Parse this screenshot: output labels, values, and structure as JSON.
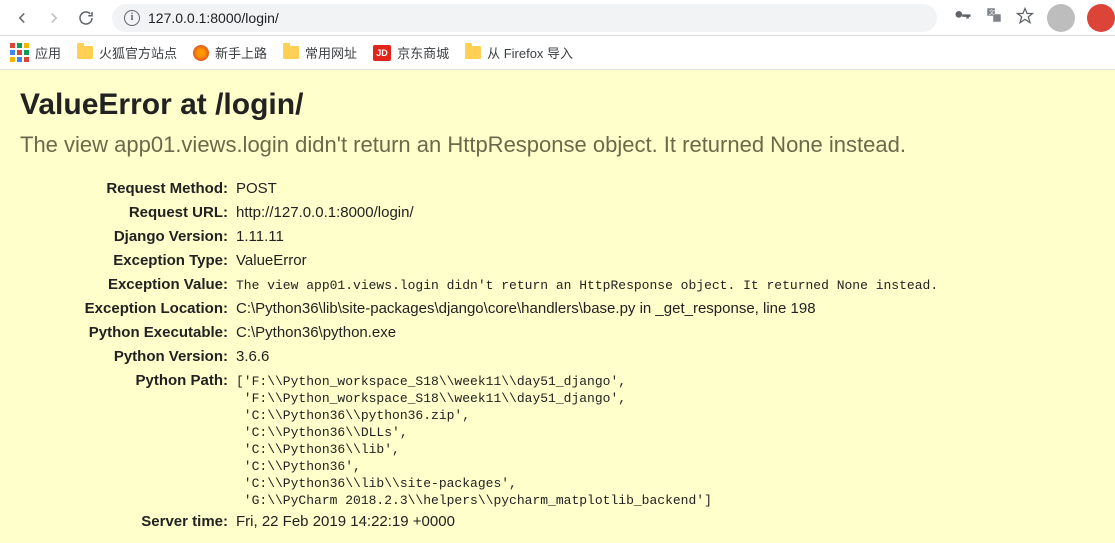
{
  "toolbar": {
    "url": "127.0.0.1:8000/login/"
  },
  "bookmarks": {
    "apps": "应用",
    "items": [
      {
        "label": "火狐官方站点",
        "icon": "folder"
      },
      {
        "label": "新手上路",
        "icon": "firefox"
      },
      {
        "label": "常用网址",
        "icon": "folder"
      },
      {
        "label": "京东商城",
        "icon": "jd"
      },
      {
        "label": "从 Firefox 导入",
        "icon": "folder"
      }
    ]
  },
  "error": {
    "title": "ValueError at /login/",
    "subtitle": "The view app01.views.login didn't return an HttpResponse object. It returned None instead.",
    "rows": {
      "request_method": {
        "label": "Request Method:",
        "value": "POST"
      },
      "request_url": {
        "label": "Request URL:",
        "value": "http://127.0.0.1:8000/login/"
      },
      "django_version": {
        "label": "Django Version:",
        "value": "1.11.11"
      },
      "exception_type": {
        "label": "Exception Type:",
        "value": "ValueError"
      },
      "exception_value": {
        "label": "Exception Value:",
        "value": "The view app01.views.login didn't return an HttpResponse object. It returned None instead."
      },
      "exception_location": {
        "label": "Exception Location:",
        "value": "C:\\Python36\\lib\\site-packages\\django\\core\\handlers\\base.py in _get_response, line 198"
      },
      "python_executable": {
        "label": "Python Executable:",
        "value": "C:\\Python36\\python.exe"
      },
      "python_version": {
        "label": "Python Version:",
        "value": "3.6.6"
      },
      "python_path": {
        "label": "Python Path:",
        "value": "['F:\\\\Python_workspace_S18\\\\week11\\\\day51_django',\n 'F:\\\\Python_workspace_S18\\\\week11\\\\day51_django',\n 'C:\\\\Python36\\\\python36.zip',\n 'C:\\\\Python36\\\\DLLs',\n 'C:\\\\Python36\\\\lib',\n 'C:\\\\Python36',\n 'C:\\\\Python36\\\\lib\\\\site-packages',\n 'G:\\\\PyCharm 2018.2.3\\\\helpers\\\\pycharm_matplotlib_backend']"
      },
      "server_time": {
        "label": "Server time:",
        "value": "Fri, 22 Feb 2019 14:22:19 +0000"
      }
    }
  }
}
